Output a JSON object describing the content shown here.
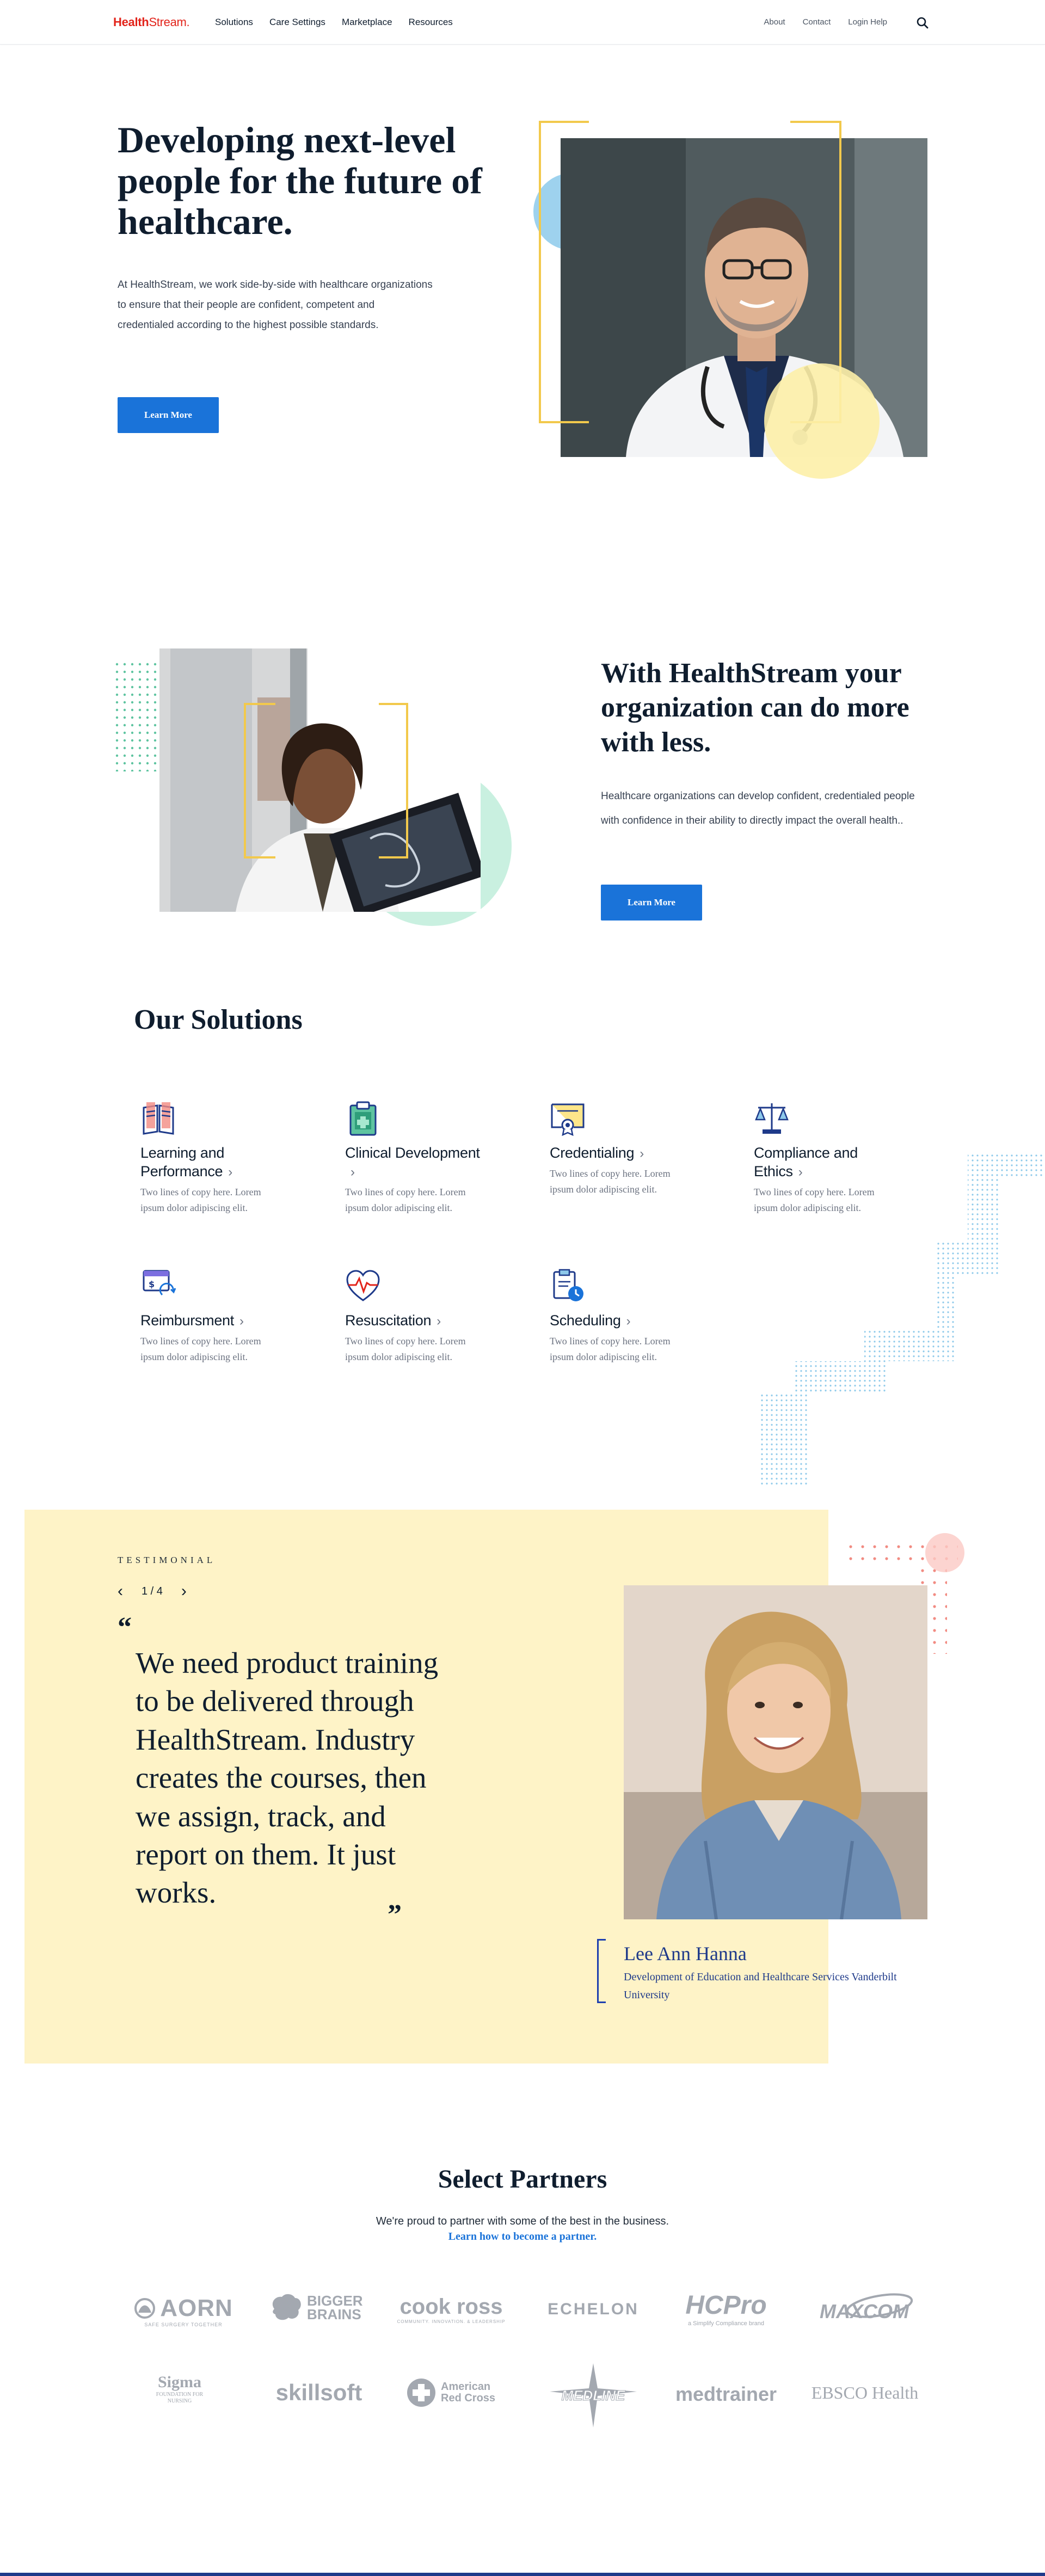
{
  "nav": {
    "logo_health": "Health",
    "logo_stream": "Stream.",
    "main_links": [
      "Solutions",
      "Care Settings",
      "Marketplace",
      "Resources"
    ],
    "util_links": [
      "About",
      "Contact",
      "Login Help"
    ]
  },
  "hero": {
    "title": "Developing next-level people for the future of healthcare.",
    "body": "At HealthStream, we work side-by-side with healthcare organizations to ensure that their people are confident, competent and credentialed according to the highest possible standards.",
    "button": "Learn More"
  },
  "section2": {
    "title": "With HealthStream your organization can do more with less.",
    "body": "Healthcare organizations can develop confident, credentialed people with confidence in their ability to directly impact the overall health..",
    "button": "Learn More"
  },
  "solutions": {
    "title": "Our Solutions",
    "items": [
      {
        "name": "Learning and Performance",
        "desc": "Two lines of copy here. Lorem ipsum dolor adipiscing elit.",
        "icon": "book-icon"
      },
      {
        "name": "Clinical Development",
        "desc": "Two lines of copy here. Lorem ipsum dolor adipiscing elit.",
        "icon": "clipboard-icon"
      },
      {
        "name": "Credentialing",
        "desc": "Two lines of copy here. Lorem ipsum dolor adipiscing elit.",
        "icon": "certificate-icon"
      },
      {
        "name": "Compliance and Ethics",
        "desc": "Two lines of copy here. Lorem ipsum dolor adipiscing elit.",
        "icon": "scales-icon"
      },
      {
        "name": "Reimbursment",
        "desc": "Two lines of copy here. Lorem ipsum dolor adipiscing elit.",
        "icon": "payment-icon"
      },
      {
        "name": "Resuscitation",
        "desc": "Two lines of copy here. Lorem ipsum dolor adipiscing elit.",
        "icon": "heartbeat-icon"
      },
      {
        "name": "Scheduling",
        "desc": "Two lines of copy here. Lorem ipsum dolor adipiscing elit.",
        "icon": "schedule-icon"
      }
    ]
  },
  "testimonial": {
    "label": "TESTIMONIAL",
    "pager": "1 / 4",
    "quote": "We need product training to be delivered through HealthStream. Industry creates the courses, then we assign, track, and report on them. It just works.",
    "author": "Lee Ann Hanna",
    "role": "Development of Education and Healthcare Services Vanderbilt University"
  },
  "partners": {
    "title": "Select Partners",
    "subtitle": "We're proud to partner with some of the best in the business.",
    "link": "Learn how to become a partner.",
    "logos": [
      "AORN",
      "BIGGER BRAINS",
      "cook ross",
      "ECHELON",
      "HCPro",
      "MAXCOM",
      "Sigma",
      "skillsoft",
      "American Red Cross",
      "MEDLINE",
      "medtrainer",
      "EBSCO Health"
    ],
    "logo_taglines": {
      "aorn": "SAFE SURGERY TOGETHER",
      "cookross": "COMMUNITY. INNOVATION. & LEADERSHIP",
      "hcpro": "a Simplify Compliance brand",
      "sigma": "FOUNDATION FOR NURSING"
    }
  },
  "colors": {
    "brand_red": "#e2231a",
    "primary_blue": "#1a73d9",
    "navy": "#0f1d2e",
    "gold": "#f2c94c",
    "testimonial_bg": "#fef3c7"
  }
}
